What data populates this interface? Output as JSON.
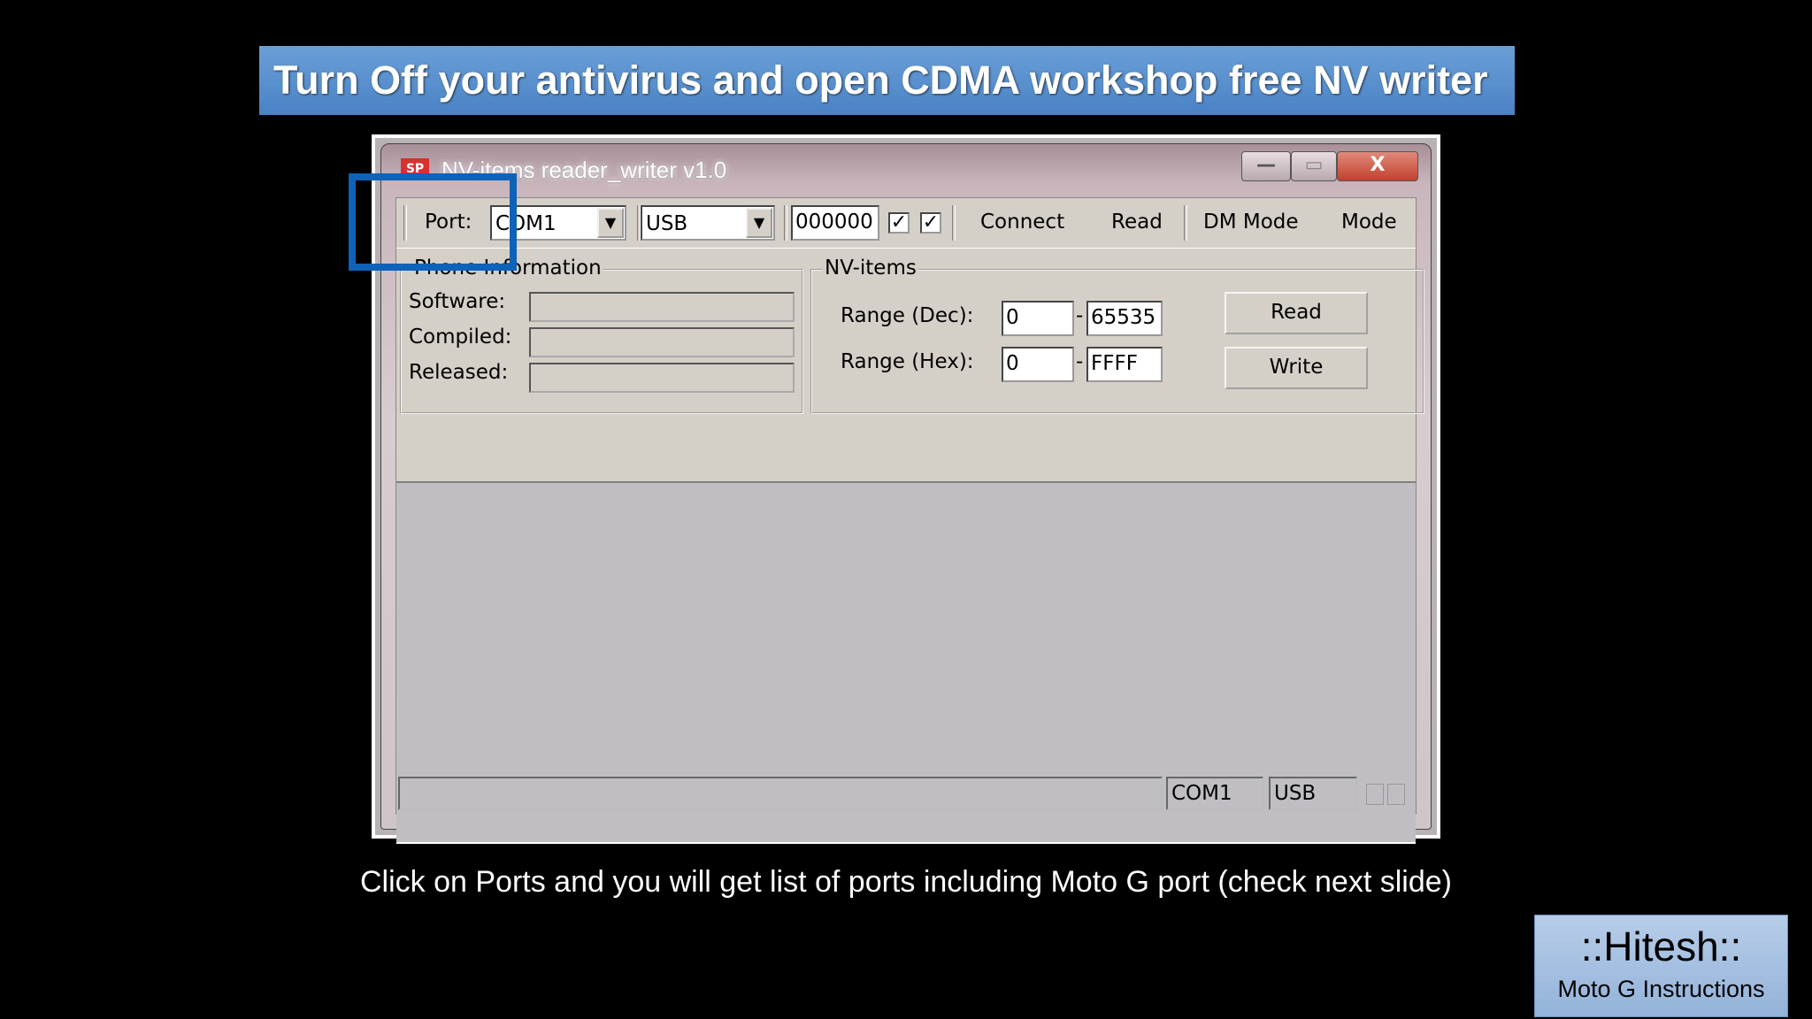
{
  "slide": {
    "title": "Turn Off your antivirus and open CDMA workshop free NV writer",
    "caption": "Click on Ports and you will get list of ports including Moto G port (check next slide)",
    "badge_name": "::Hitesh::",
    "badge_sub": "Moto G Instructions"
  },
  "window": {
    "icon_text": "SP",
    "title": "NV-items reader_writer v1.0",
    "min_glyph": "—",
    "max_glyph": "▭",
    "close_glyph": "X"
  },
  "toolbar": {
    "port_label": "Port:",
    "port_value": "COM1",
    "conn_value": "USB",
    "code_value": "000000",
    "check1": "✓",
    "check2": "✓",
    "connect": "Connect",
    "read": "Read",
    "dm_mode": "DM Mode",
    "mode": "Mode",
    "dropdown_glyph": "▼"
  },
  "phone_info": {
    "legend": "Phone Information",
    "software_label": "Software:",
    "compiled_label": "Compiled:",
    "released_label": "Released:",
    "software_value": "",
    "compiled_value": "",
    "released_value": ""
  },
  "nv_items": {
    "legend": "NV-items",
    "range_dec_label": "Range (Dec):",
    "range_hex_label": "Range (Hex):",
    "dec_from": "0",
    "dec_to": "65535",
    "hex_from": "0",
    "hex_to": "FFFF",
    "dash": "-",
    "read_button": "Read",
    "write_button": "Write"
  },
  "status": {
    "message": "",
    "port": "COM1",
    "conn": "USB"
  },
  "colors": {
    "highlight": "#0e62b8",
    "banner": "#4a82c6"
  }
}
